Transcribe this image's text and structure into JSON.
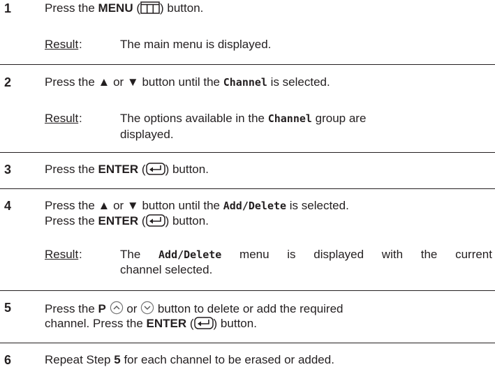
{
  "steps": [
    {
      "number": "1",
      "instruction": {
        "pre": "Press the ",
        "bold": "MENU",
        "open": " (",
        "close": ") button.",
        "icon": "menu-icon"
      },
      "result_label": "Result",
      "result_colon": ":",
      "result_text": "The main menu is displayed."
    },
    {
      "number": "2",
      "instruction": {
        "pre": "Press the ▲ or ▼ button until the ",
        "mono": "Channel",
        "post": " is selected."
      },
      "result_label": "Result",
      "result_colon": ":",
      "result_line1": {
        "pre": "The options available in the ",
        "mono": "Channel",
        "post": " group are"
      },
      "result_line2": "displayed."
    },
    {
      "number": "3",
      "instruction": {
        "pre": "Press the ",
        "bold": "ENTER",
        "open": " (",
        "close": ") button.",
        "icon": "enter-icon"
      }
    },
    {
      "number": "4",
      "instruction": {
        "pre": "Press the ▲ or ▼ button until the ",
        "mono": "Add/Delete",
        "post": " is selected."
      },
      "instruction2": {
        "pre": "Press the ",
        "bold": "ENTER",
        "open": " (",
        "close": ") button.",
        "icon": "enter-icon"
      },
      "result_label": "Result",
      "result_colon": ":",
      "result_line1": {
        "pre": "The ",
        "mono": "Add/Delete",
        "post": " menu is displayed with the current"
      },
      "result_line2": "channel selected."
    },
    {
      "number": "5",
      "instruction": {
        "pre": "Press the ",
        "bold": "P",
        "mid1": " or ",
        "post": " button to delete or add the required",
        "icons": [
          "up-circle-icon",
          "down-circle-icon"
        ]
      },
      "instruction2": {
        "pre": "channel. Press the ",
        "bold": "ENTER",
        "open": " (",
        "close": ") button.",
        "icon": "enter-icon"
      }
    },
    {
      "number": "6",
      "instruction": {
        "pre": "Repeat Step ",
        "bold": "5",
        "post": " for each channel to be erased or added."
      }
    }
  ]
}
